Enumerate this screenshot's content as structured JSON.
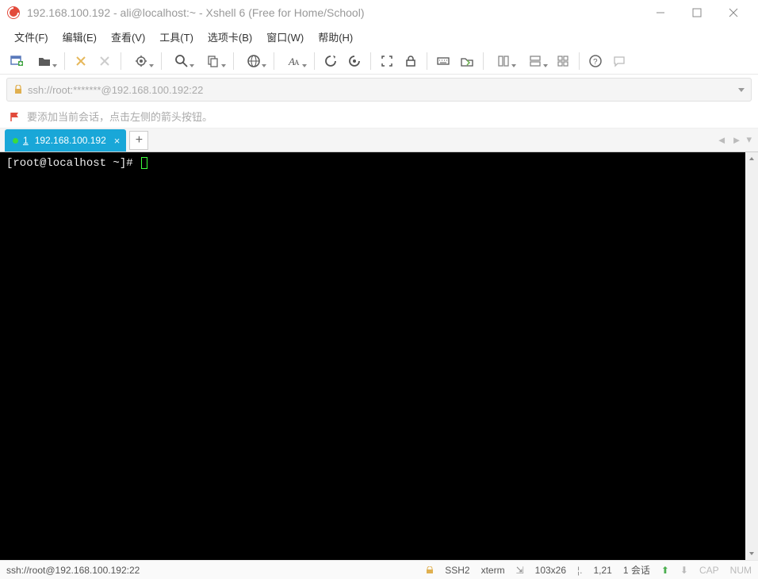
{
  "window": {
    "title": "192.168.100.192 - ali@localhost:~ - Xshell 6 (Free for Home/School)"
  },
  "menu": {
    "file": "文件(F)",
    "edit": "编辑(E)",
    "view": "查看(V)",
    "tool": "工具(T)",
    "tab": "选项卡(B)",
    "window": "窗口(W)",
    "help": "帮助(H)"
  },
  "toolbar_icons": [
    "new-session-icon",
    "open-folder-icon",
    "sep",
    "reconnect-icon",
    "disconnect-icon",
    "sep",
    "properties-icon",
    "sep",
    "search-icon",
    "copy-icon",
    "sep",
    "globe-icon",
    "sep",
    "font-icon",
    "sep",
    "macro1-icon",
    "macro2-icon",
    "sep",
    "fullscreen-icon",
    "lock-icon",
    "sep",
    "keyboard-icon",
    "sftp-icon",
    "sep",
    "tile-h-icon",
    "tile-v-icon",
    "tile-grid-icon",
    "sep",
    "help-icon",
    "chat-icon"
  ],
  "address": {
    "url": "ssh://root:*******@192.168.100.192:22"
  },
  "hint": {
    "text": "要添加当前会话，点击左侧的箭头按钮。"
  },
  "tabs": {
    "active": {
      "index": "1",
      "label": "192.168.100.192"
    }
  },
  "terminal": {
    "prompt": "[root@localhost ~]# "
  },
  "status": {
    "left": "ssh://root@192.168.100.192:22",
    "proto": "SSH2",
    "term": "xterm",
    "size": "103x26",
    "pos": "1,21",
    "sessions": "1 会话",
    "cap": "CAP",
    "num": "NUM"
  }
}
